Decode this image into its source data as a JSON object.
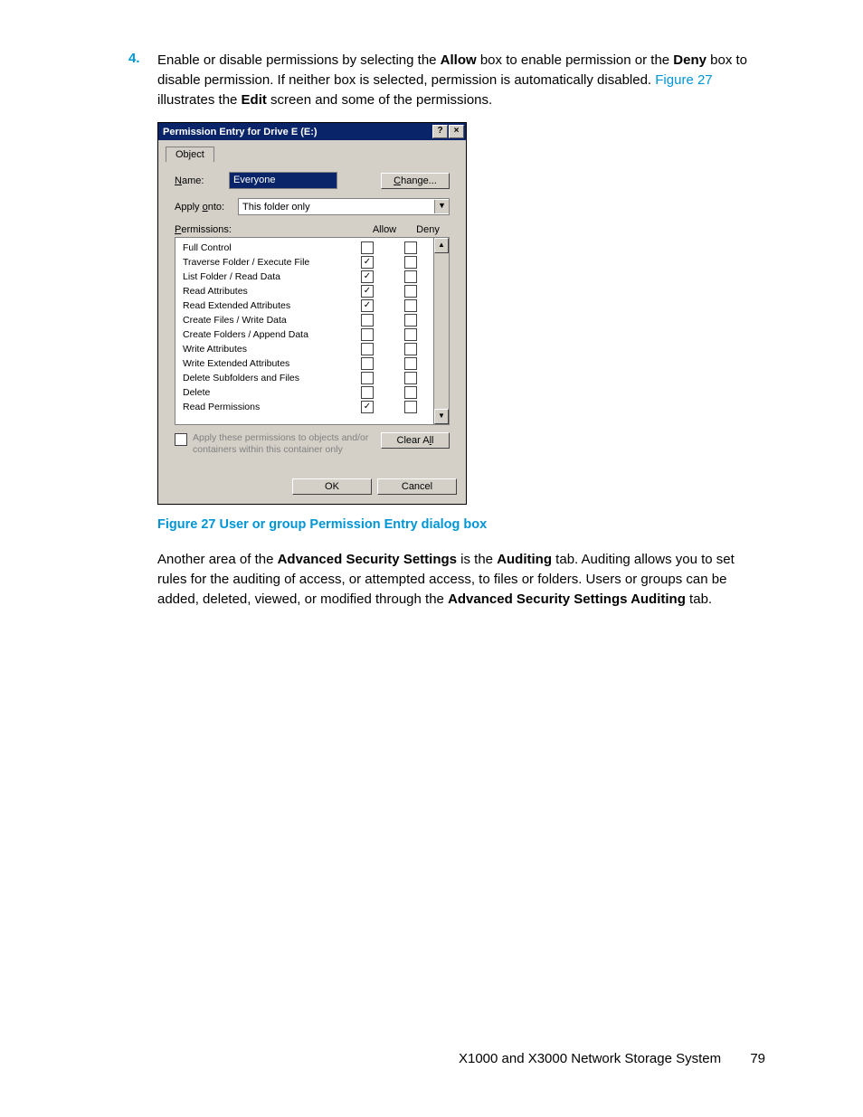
{
  "step": {
    "number": "4.",
    "text_parts": {
      "p1": "Enable or disable permissions by selecting the ",
      "b1": "Allow",
      "p2": " box to enable permission or the ",
      "b2": "Deny",
      "p3": " box to disable permission. If neither box is selected, permission is automatically disabled. ",
      "link": "Figure 27",
      "p4": " illustrates the ",
      "b3": "Edit",
      "p5": " screen and some of the permissions."
    }
  },
  "dialog": {
    "title": "Permission Entry for Drive E (E:)",
    "help_btn": "?",
    "close_btn": "×",
    "tab": "Object",
    "name_label": "Name:",
    "name_value": "Everyone",
    "change_btn": "Change...",
    "apply_label": "Apply onto:",
    "apply_value": "This folder only",
    "perm_label": "Permissions:",
    "col_allow": "Allow",
    "col_deny": "Deny",
    "rows": [
      {
        "name": "Full Control",
        "allow": false,
        "deny": false
      },
      {
        "name": "Traverse Folder / Execute File",
        "allow": true,
        "deny": false
      },
      {
        "name": "List Folder / Read Data",
        "allow": true,
        "deny": false
      },
      {
        "name": "Read Attributes",
        "allow": true,
        "deny": false
      },
      {
        "name": "Read Extended Attributes",
        "allow": true,
        "deny": false
      },
      {
        "name": "Create Files / Write Data",
        "allow": false,
        "deny": false
      },
      {
        "name": "Create Folders / Append Data",
        "allow": false,
        "deny": false
      },
      {
        "name": "Write Attributes",
        "allow": false,
        "deny": false
      },
      {
        "name": "Write Extended Attributes",
        "allow": false,
        "deny": false
      },
      {
        "name": "Delete Subfolders and Files",
        "allow": false,
        "deny": false
      },
      {
        "name": "Delete",
        "allow": false,
        "deny": false
      },
      {
        "name": "Read Permissions",
        "allow": true,
        "deny": false
      }
    ],
    "apply_check_label": "Apply these permissions to objects and/or containers within this container only",
    "clear_all": "Clear All",
    "ok": "OK",
    "cancel": "Cancel"
  },
  "figure_caption": "Figure 27 User or group Permission Entry dialog box",
  "para2": {
    "p1": "Another area of the ",
    "b1": "Advanced Security Settings",
    "p2": " is the ",
    "b2": "Auditing",
    "p3": " tab. Auditing allows you to set rules for the auditing of access, or attempted access, to files or folders. Users or groups can be added, deleted, viewed, or modified through the ",
    "b3": "Advanced Security Settings Auditing",
    "p4": " tab."
  },
  "footer": {
    "text": "X1000 and X3000 Network Storage System",
    "page": "79"
  }
}
